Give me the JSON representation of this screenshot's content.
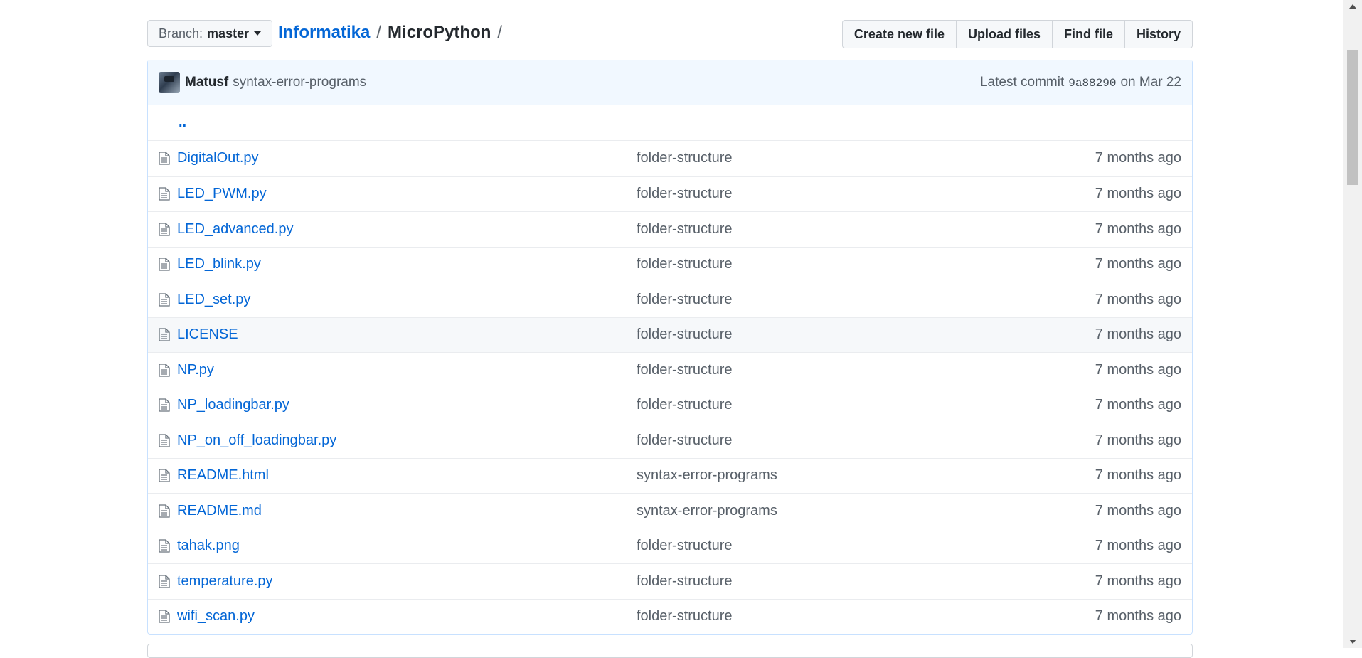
{
  "branch": {
    "label": "Branch:",
    "value": "master"
  },
  "breadcrumb": {
    "repo": "Informatika",
    "sep1": "/",
    "current": "MicroPython",
    "sep2": "/"
  },
  "actions": {
    "create": "Create new file",
    "upload": "Upload files",
    "find": "Find file",
    "history": "History"
  },
  "commit": {
    "author": "Matusf",
    "message": "syntax-error-programs",
    "latest_label": "Latest commit",
    "sha": "9a88290",
    "date": "on Mar 22"
  },
  "parent_link": "..",
  "files": [
    {
      "name": "DigitalOut.py",
      "commit": "folder-structure",
      "age": "7 months ago"
    },
    {
      "name": "LED_PWM.py",
      "commit": "folder-structure",
      "age": "7 months ago"
    },
    {
      "name": "LED_advanced.py",
      "commit": "folder-structure",
      "age": "7 months ago"
    },
    {
      "name": "LED_blink.py",
      "commit": "folder-structure",
      "age": "7 months ago"
    },
    {
      "name": "LED_set.py",
      "commit": "folder-structure",
      "age": "7 months ago"
    },
    {
      "name": "LICENSE",
      "commit": "folder-structure",
      "age": "7 months ago"
    },
    {
      "name": "NP.py",
      "commit": "folder-structure",
      "age": "7 months ago"
    },
    {
      "name": "NP_loadingbar.py",
      "commit": "folder-structure",
      "age": "7 months ago"
    },
    {
      "name": "NP_on_off_loadingbar.py",
      "commit": "folder-structure",
      "age": "7 months ago"
    },
    {
      "name": "README.html",
      "commit": "syntax-error-programs",
      "age": "7 months ago"
    },
    {
      "name": "README.md",
      "commit": "syntax-error-programs",
      "age": "7 months ago"
    },
    {
      "name": "tahak.png",
      "commit": "folder-structure",
      "age": "7 months ago"
    },
    {
      "name": "temperature.py",
      "commit": "folder-structure",
      "age": "7 months ago"
    },
    {
      "name": "wifi_scan.py",
      "commit": "folder-structure",
      "age": "7 months ago"
    }
  ],
  "icons": {
    "file": "file-icon",
    "caret": "caret-down-icon"
  },
  "colors": {
    "link": "#0366d6",
    "commit_bar_bg": "#f1f8ff",
    "hover_row_bg": "#f6f8fa"
  }
}
